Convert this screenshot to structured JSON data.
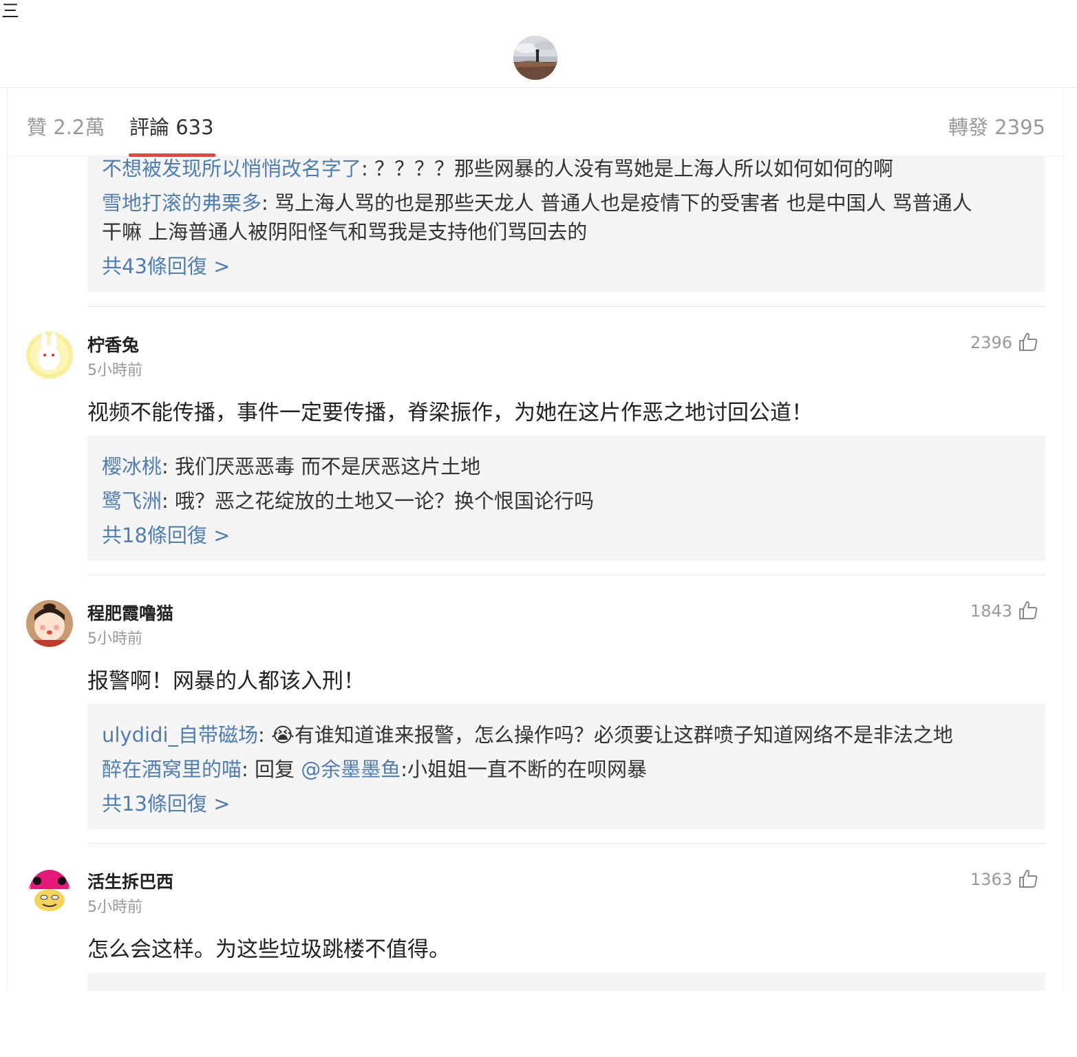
{
  "header": {
    "menu_glyph": "三"
  },
  "tabs": {
    "likes_label": "贊 2.2萬",
    "comments_label": "評論 633",
    "reposts_label": "轉發 2395"
  },
  "top_reply_block": {
    "replies": [
      {
        "user": "不想被发现所以悄悄改名字了",
        "text": ": ？？？？那些网暴的人没有骂她是上海人所以如何如何的啊"
      },
      {
        "user": "雪地打滚的弗栗多",
        "text": ": 骂上海人骂的也是那些天龙人 普通人也是疫情下的受害者 也是中国人 骂普通人",
        "text2": "干嘛 上海普通人被阴阳怪气和骂我是支持他们骂回去的"
      }
    ],
    "more": "共43條回復 >"
  },
  "comments": [
    {
      "name": "柠香兔",
      "time": "5小時前",
      "likes": "2396",
      "text": "视频不能传播，事件一定要传播，脊梁振作，为她在这片作恶之地讨回公道！",
      "replies": [
        {
          "user": "樱冰桃",
          "text": ": 我们厌恶恶毒 而不是厌恶这片土地"
        },
        {
          "user": "鹭飞洲",
          "text": ": 哦？恶之花绽放的土地又一论？换个恨国论行吗"
        }
      ],
      "more": "共18條回復 >"
    },
    {
      "name": "程肥霞噜猫",
      "time": "5小時前",
      "likes": "1843",
      "text": "报警啊！网暴的人都该入刑！",
      "replies": [
        {
          "user": "ulydidi_自带磁场",
          "text": ": 😭有谁知道谁来报警，怎么操作吗？必须要让这群喷子知道网络不是非法之地"
        },
        {
          "user": "醉在酒窝里的喵",
          "text": ": 回复 ",
          "mention": "@余墨墨鱼",
          "text2": ":小姐姐一直不断的在呗网暴"
        }
      ],
      "more": "共13條回復 >"
    },
    {
      "name": "活生拆巴西",
      "time": "5小時前",
      "likes": "1363",
      "text": "怎么会这样。为这些垃圾跳楼不值得。"
    }
  ],
  "colors": {
    "accent": "#e8443b",
    "link": "#4f7db3",
    "reply_bg": "#f5f5f5"
  },
  "icons": {
    "like": "thumbs-up-icon",
    "menu": "menu-icon"
  }
}
